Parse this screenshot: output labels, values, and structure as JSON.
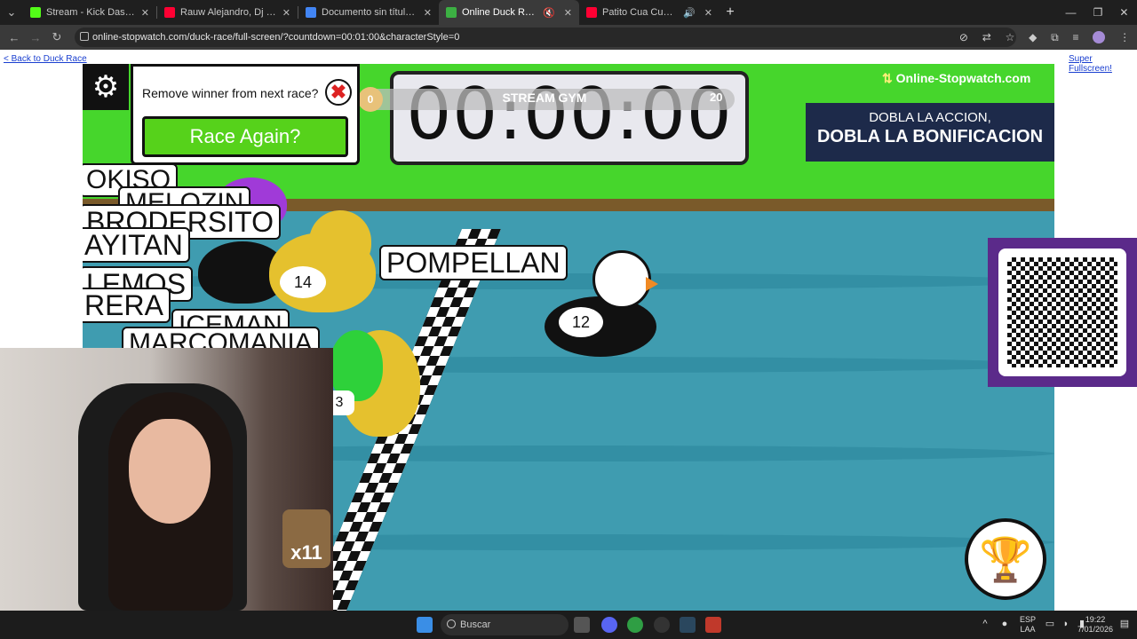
{
  "browser": {
    "tabs": [
      {
        "title": "Stream - Kick Dashboard",
        "favicon_color": "#53fc18"
      },
      {
        "title": "Rauw Alejandro, Dj Playero - Dí",
        "favicon_color": "#ff0033"
      },
      {
        "title": "Documento sin título - Docum",
        "favicon_color": "#4285f4"
      },
      {
        "title": "Online Duck Race Game",
        "favicon_color": "#3cb043"
      },
      {
        "title": "Patito Cua Cua - YouTube",
        "favicon_color": "#ff0033"
      }
    ],
    "active_tab_index": 3,
    "url": "online-stopwatch.com/duck-race/full-screen/?countdown=00:01:00&characterStyle=0",
    "new_tab": "+"
  },
  "page": {
    "back_link": "< Back to Duck Race",
    "fullscreen_link": "Super Fullscreen!"
  },
  "game": {
    "popup_text": "Remove winner from next race?",
    "race_again": "Race Again?",
    "timer": "00:00:00",
    "goal_start": "0",
    "goal_label": "STREAM GYM",
    "goal_end": "20",
    "brand": "Online-Stopwatch.com",
    "promo_line1": "DOBLA LA ACCION,",
    "promo_line2": "DOBLA LA BONIFICACION",
    "racers": [
      "OKISO",
      "MELOZIN",
      "BRODERSITO",
      "AYITAN",
      "LEMOS",
      "RERA",
      "ICEMAN",
      "MARCOMANIA"
    ],
    "winner_name": "POMPELLAN",
    "winner_number": "12",
    "duck_number": "14",
    "partial_number": "3",
    "colors": {
      "grass": "#46d62c",
      "water": "#3f9cb0",
      "duck": "#e5c12e",
      "button": "#56d21b"
    }
  },
  "webcam": {
    "sticker_text": "x11"
  },
  "taskbar": {
    "search_placeholder": "Buscar",
    "lang_1": "ESP",
    "lang_2": "LAA",
    "time": "19:22",
    "date": "7/01/2026"
  }
}
